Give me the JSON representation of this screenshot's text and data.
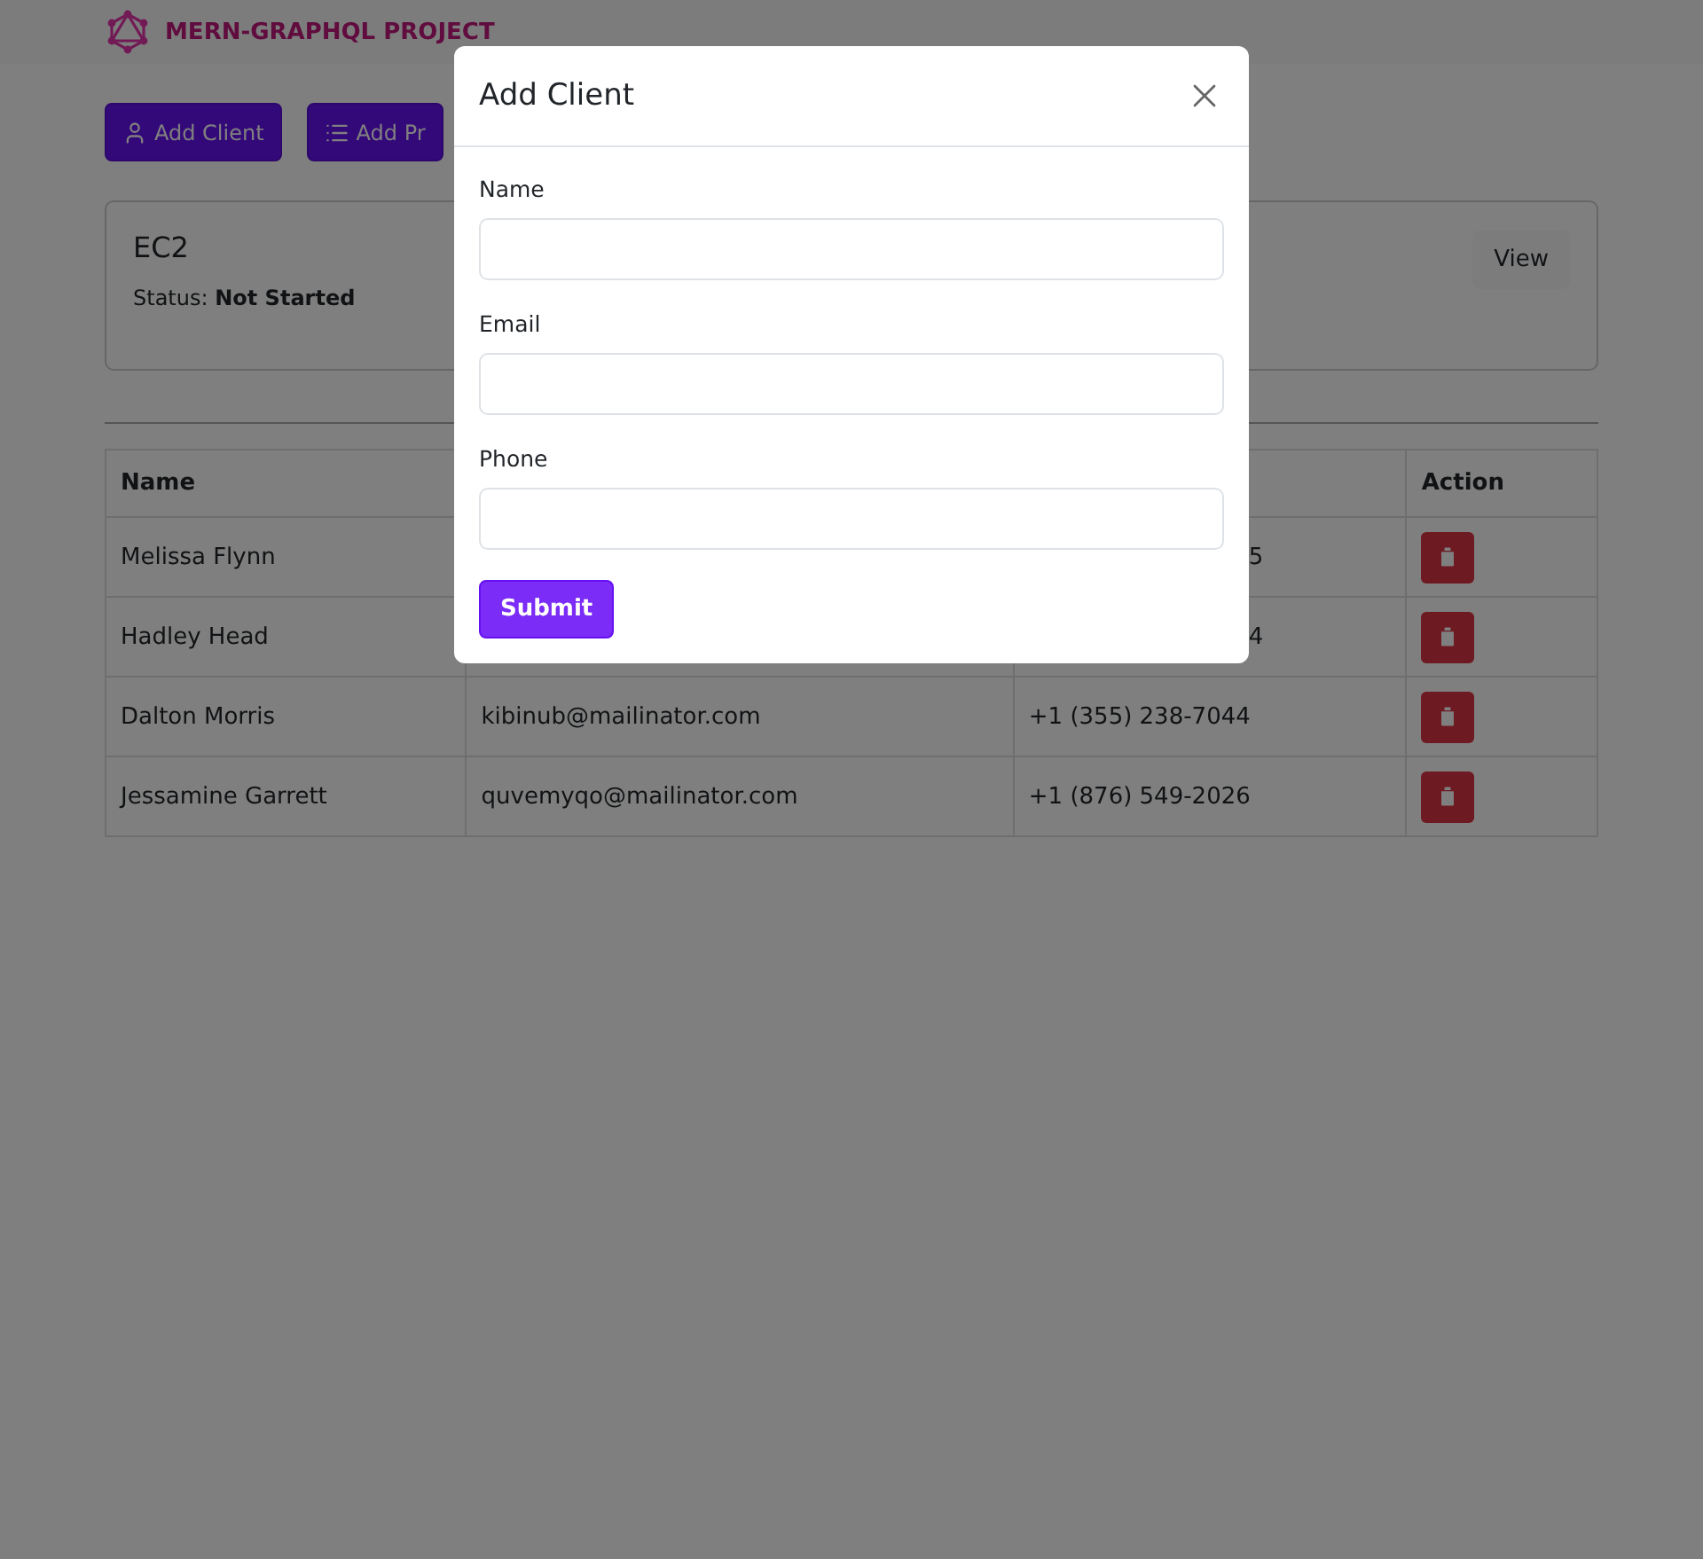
{
  "navbar": {
    "brand": "MERN-GRAPHQL PROJECT"
  },
  "actions": [
    {
      "label": "Add Client",
      "kind": "user"
    },
    {
      "label": "Add Pr",
      "kind": "list"
    }
  ],
  "project_card": {
    "title": "EC2",
    "status_label": "Status:",
    "status": "Not Started",
    "button": "View"
  },
  "table": {
    "columns": [
      "Name",
      "",
      "",
      "Action"
    ],
    "rows": [
      {
        "name": "Melissa Flynn",
        "email": "",
        "phone": "5",
        "phone_clipped": true
      },
      {
        "name": "Hadley Head",
        "email": "",
        "phone": "4",
        "phone_clipped": true
      },
      {
        "name": "Dalton Morris",
        "email": "kibinub@mailinator.com",
        "phone": "+1 (355) 238-7044",
        "phone_clipped": false
      },
      {
        "name": "Jessamine Garrett",
        "email": "quvemyqo@mailinator.com",
        "phone": "+1 (876) 549-2026",
        "phone_clipped": false
      }
    ]
  },
  "modal": {
    "title": "Add Client",
    "fields": [
      {
        "label": "Name"
      },
      {
        "label": "Email"
      },
      {
        "label": "Phone"
      }
    ],
    "submit": "Submit"
  }
}
